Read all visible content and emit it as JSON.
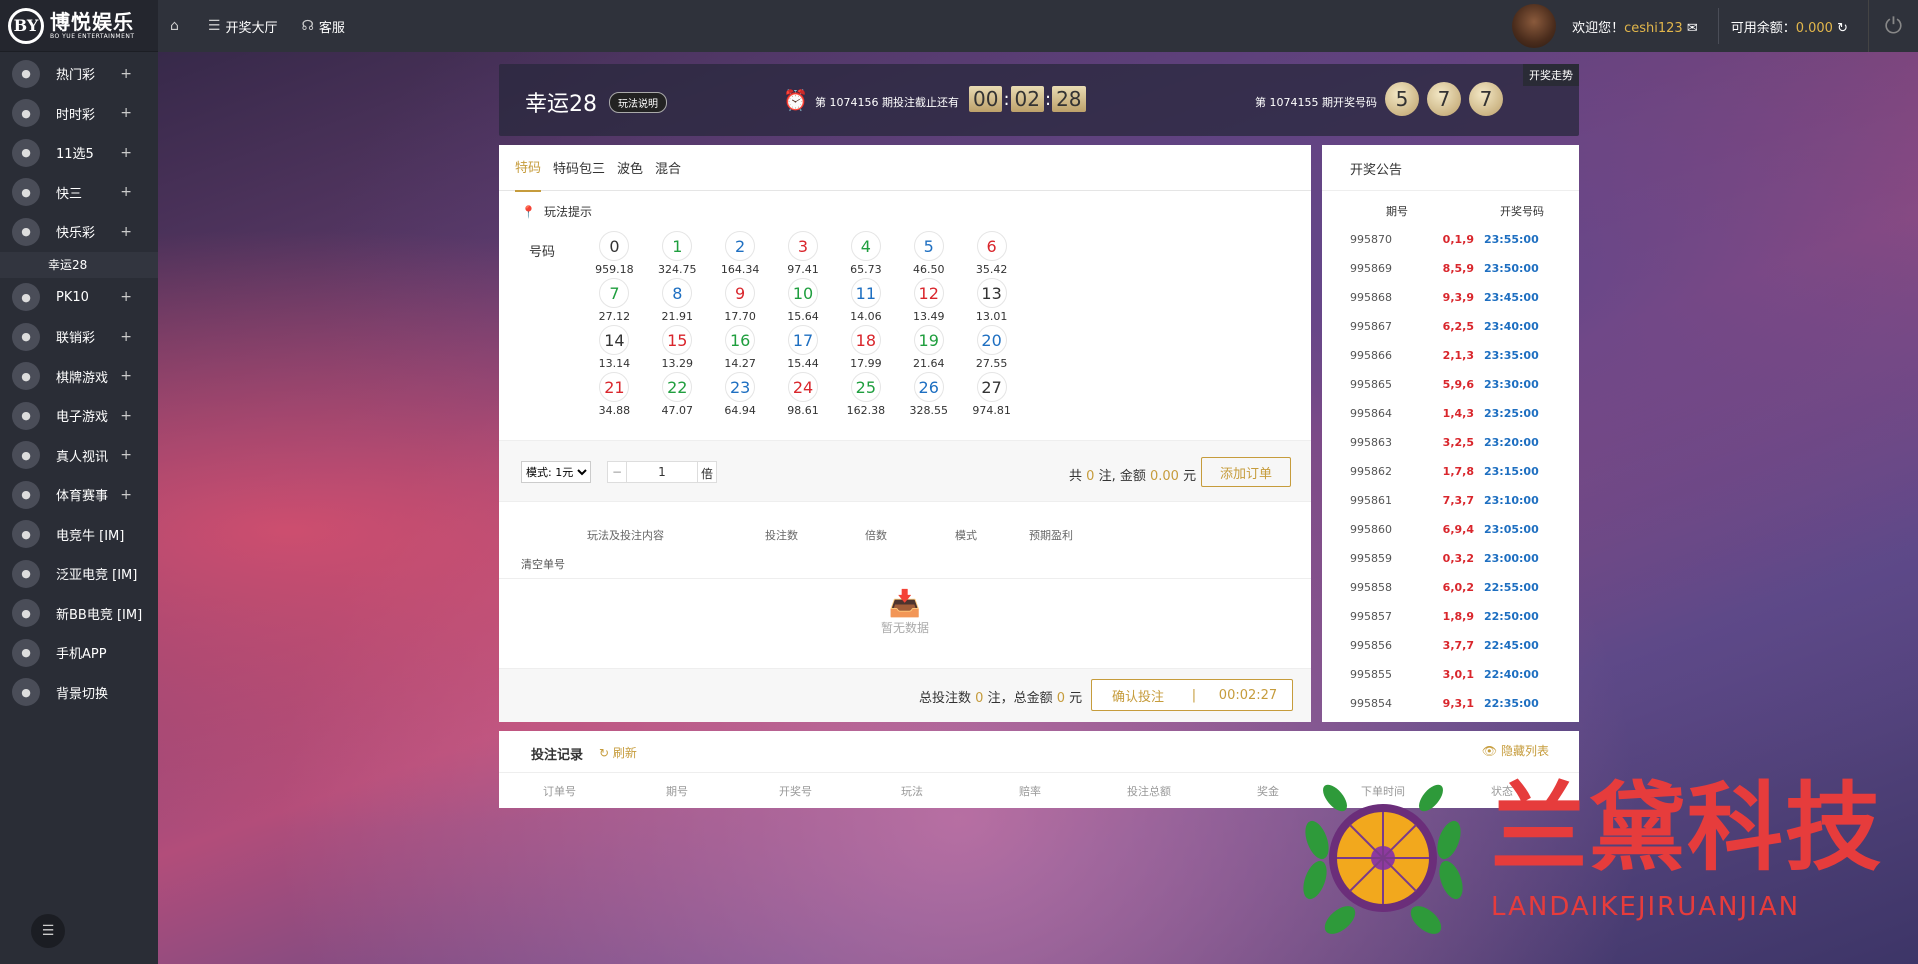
{
  "logo": {
    "mark": "BY",
    "cn": "博悦娱乐",
    "en": "BO YUE ENTERTAINMENT"
  },
  "sidebar": {
    "items": [
      {
        "icon": "more-icon",
        "label": "热门彩",
        "plus": "+"
      },
      {
        "icon": "clock-lottery-icon",
        "label": "时时彩",
        "plus": "+"
      },
      {
        "icon": "eleven-five-icon",
        "label": "11选5",
        "plus": "+"
      },
      {
        "icon": "dice-icon",
        "label": "快三",
        "plus": "+"
      },
      {
        "icon": "happy-lottery-icon",
        "label": "快乐彩",
        "plus": "+"
      },
      {
        "icon": "",
        "label": "幸运28",
        "plus": "",
        "sub": true
      },
      {
        "icon": "pk10-icon",
        "label": "PK10",
        "plus": "+"
      },
      {
        "icon": "more-icon",
        "label": "联销彩",
        "plus": "+"
      },
      {
        "icon": "cards-icon",
        "label": "棋牌游戏",
        "plus": "+"
      },
      {
        "icon": "slots-icon",
        "label": "电子游戏",
        "plus": "+"
      },
      {
        "icon": "dealer-icon",
        "label": "真人视讯",
        "plus": "+"
      },
      {
        "icon": "sports-icon",
        "label": "体育赛事",
        "plus": "+"
      },
      {
        "icon": "bull-icon",
        "label": "电竞牛 [IM]",
        "plus": ""
      },
      {
        "icon": "bull-icon",
        "label": "泛亚电竞 [IM]",
        "plus": ""
      },
      {
        "icon": "bull-icon",
        "label": "新BB电竞 [IM]",
        "plus": ""
      },
      {
        "icon": "phone-icon",
        "label": "手机APP",
        "plus": ""
      },
      {
        "icon": "background-switch-icon",
        "label": "背景切换",
        "plus": ""
      }
    ]
  },
  "topbar": {
    "home_icon": "home-icon",
    "lobby": "开奖大厅",
    "service": "客服",
    "welcome": "欢迎您！",
    "username": "ceshi123",
    "balance_label": "可用余额：",
    "balance": "0.000"
  },
  "game": {
    "title": "幸运28",
    "help": "玩法说明",
    "issue_prefix": "第",
    "issue": "1074156",
    "issue_suffix": "期投注截止还有",
    "timer": [
      "00",
      "02",
      "28"
    ],
    "last_prefix": "第",
    "last_issue": "1074155",
    "last_suffix": "期开奖号码",
    "last_balls": [
      "5",
      "7",
      "7"
    ],
    "trend": "开奖走势"
  },
  "tabs": [
    "特码",
    "特码包三",
    "波色",
    "混合"
  ],
  "tip": "玩法提示",
  "number_label": "号码",
  "numbers": [
    {
      "n": "0",
      "odds": "959.18",
      "color": "gray"
    },
    {
      "n": "1",
      "odds": "324.75",
      "color": "green"
    },
    {
      "n": "2",
      "odds": "164.34",
      "color": "blue"
    },
    {
      "n": "3",
      "odds": "97.41",
      "color": "red"
    },
    {
      "n": "4",
      "odds": "65.73",
      "color": "green"
    },
    {
      "n": "5",
      "odds": "46.50",
      "color": "blue"
    },
    {
      "n": "6",
      "odds": "35.42",
      "color": "red"
    },
    {
      "n": "7",
      "odds": "27.12",
      "color": "green"
    },
    {
      "n": "8",
      "odds": "21.91",
      "color": "blue"
    },
    {
      "n": "9",
      "odds": "17.70",
      "color": "red"
    },
    {
      "n": "10",
      "odds": "15.64",
      "color": "green"
    },
    {
      "n": "11",
      "odds": "14.06",
      "color": "blue"
    },
    {
      "n": "12",
      "odds": "13.49",
      "color": "red"
    },
    {
      "n": "13",
      "odds": "13.01",
      "color": "gray"
    },
    {
      "n": "14",
      "odds": "13.14",
      "color": "gray"
    },
    {
      "n": "15",
      "odds": "13.29",
      "color": "red"
    },
    {
      "n": "16",
      "odds": "14.27",
      "color": "green"
    },
    {
      "n": "17",
      "odds": "15.44",
      "color": "blue"
    },
    {
      "n": "18",
      "odds": "17.99",
      "color": "red"
    },
    {
      "n": "19",
      "odds": "21.64",
      "color": "green"
    },
    {
      "n": "20",
      "odds": "27.55",
      "color": "blue"
    },
    {
      "n": "21",
      "odds": "34.88",
      "color": "red"
    },
    {
      "n": "22",
      "odds": "47.07",
      "color": "green"
    },
    {
      "n": "23",
      "odds": "64.94",
      "color": "blue"
    },
    {
      "n": "24",
      "odds": "98.61",
      "color": "red"
    },
    {
      "n": "25",
      "odds": "162.38",
      "color": "green"
    },
    {
      "n": "26",
      "odds": "328.55",
      "color": "blue"
    },
    {
      "n": "27",
      "odds": "974.81",
      "color": "gray"
    }
  ],
  "bet": {
    "mode": "模式: 1元",
    "multiplier": "1",
    "bei": "倍",
    "sum_prefix": "共",
    "count": "0",
    "sum_mid": "注, 金额",
    "amount": "0.00",
    "sum_suffix": "元",
    "add_order": "添加订单"
  },
  "order_table": {
    "headers": [
      "玩法及投注内容",
      "投注数",
      "倍数",
      "模式",
      "预期盈利"
    ],
    "clear": "清空单号",
    "empty": "暂无数据"
  },
  "footer": {
    "prefix": "总投注数",
    "count": "0",
    "mid": "注，总金额",
    "amount": "0",
    "suffix": "元",
    "confirm": "确认投注",
    "sep": "|",
    "timer": "00:02:27"
  },
  "notice": {
    "title": "开奖公告",
    "headers": [
      "期号",
      "开奖号码"
    ],
    "rows": [
      [
        "995870",
        "0,1,9",
        "23:55:00"
      ],
      [
        "995869",
        "8,5,9",
        "23:50:00"
      ],
      [
        "995868",
        "9,3,9",
        "23:45:00"
      ],
      [
        "995867",
        "6,2,5",
        "23:40:00"
      ],
      [
        "995866",
        "2,1,3",
        "23:35:00"
      ],
      [
        "995865",
        "5,9,6",
        "23:30:00"
      ],
      [
        "995864",
        "1,4,3",
        "23:25:00"
      ],
      [
        "995863",
        "3,2,5",
        "23:20:00"
      ],
      [
        "995862",
        "1,7,8",
        "23:15:00"
      ],
      [
        "995861",
        "7,3,7",
        "23:10:00"
      ],
      [
        "995860",
        "6,9,4",
        "23:05:00"
      ],
      [
        "995859",
        "0,3,2",
        "23:00:00"
      ],
      [
        "995858",
        "6,0,2",
        "22:55:00"
      ],
      [
        "995857",
        "1,8,9",
        "22:50:00"
      ],
      [
        "995856",
        "3,7,7",
        "22:45:00"
      ],
      [
        "995855",
        "3,0,1",
        "22:40:00"
      ],
      [
        "995854",
        "9,3,1",
        "22:35:00"
      ]
    ]
  },
  "records": {
    "title": "投注记录",
    "refresh": "刷新",
    "hide": "隐藏列表",
    "columns": [
      "订单号",
      "期号",
      "开奖号",
      "玩法",
      "赔率",
      "投注总额",
      "奖金",
      "下单时间",
      "状态"
    ]
  },
  "watermark": {
    "cn": "兰黛科技",
    "en": "LANDAIKEJIRUANJIAN"
  }
}
